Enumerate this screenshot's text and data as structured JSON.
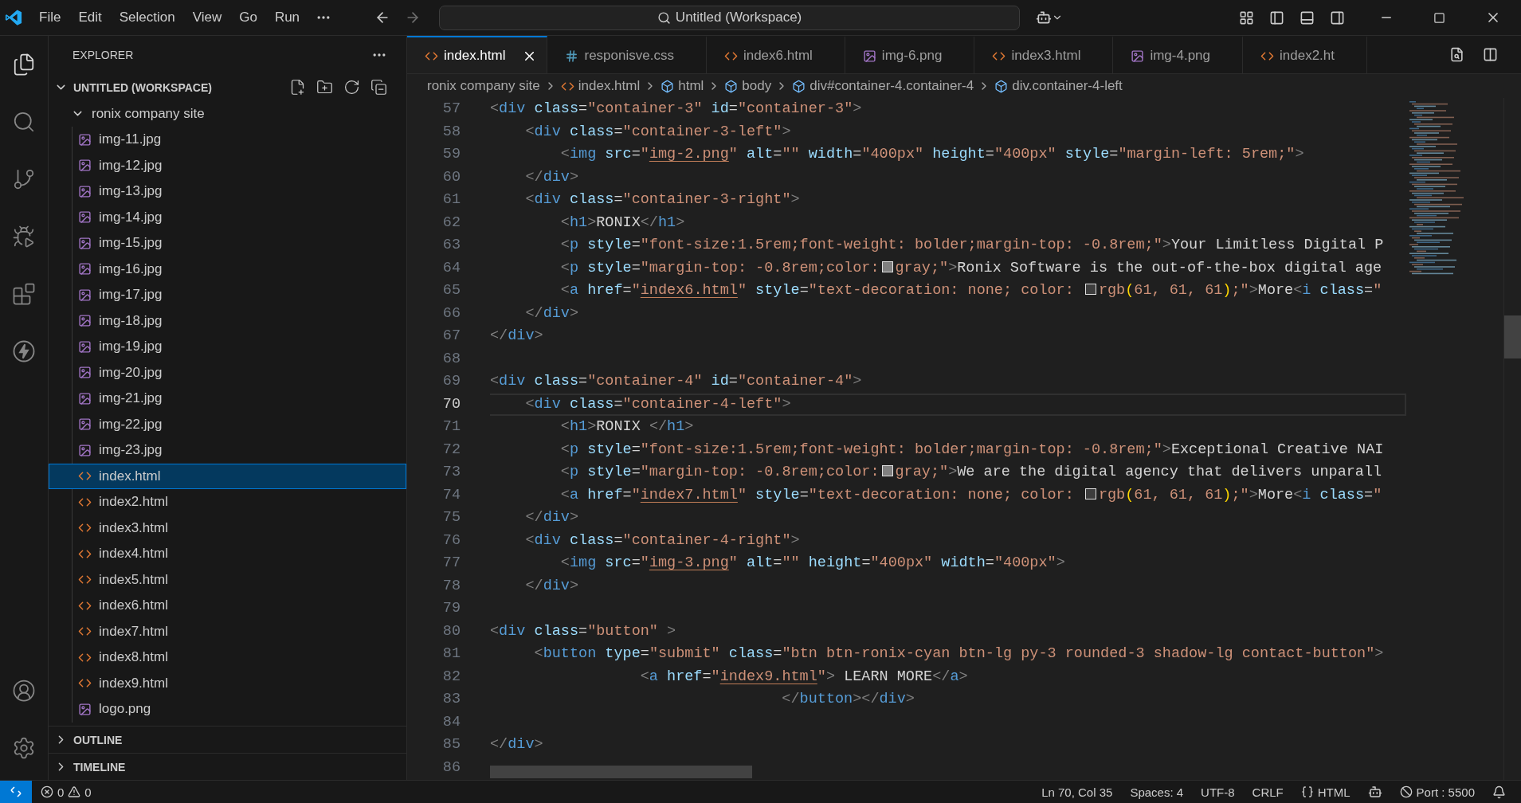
{
  "title_bar": {
    "menu": [
      "File",
      "Edit",
      "Selection",
      "View",
      "Go",
      "Run"
    ],
    "command_center": "Untitled (Workspace)"
  },
  "activity_bar": {
    "top": [
      {
        "kind": "explorer",
        "selected": true
      },
      {
        "kind": "search",
        "selected": false
      },
      {
        "kind": "source-control",
        "selected": false
      },
      {
        "kind": "run-debug",
        "selected": false
      },
      {
        "kind": "extensions",
        "selected": false
      },
      {
        "kind": "lightning",
        "selected": false
      }
    ],
    "bottom": [
      {
        "kind": "account"
      },
      {
        "kind": "settings"
      }
    ]
  },
  "sidebar": {
    "title": "EXPLORER",
    "workspace": {
      "name": "UNTITLED (WORKSPACE)",
      "expanded": true,
      "children": [
        {
          "name": "ronix company site",
          "expanded": true,
          "selected": false,
          "children": [
            {
              "name": "img-11.jpg",
              "kind": "image",
              "selected": false
            },
            {
              "name": "img-12.jpg",
              "kind": "image",
              "selected": false
            },
            {
              "name": "img-13.jpg",
              "kind": "image",
              "selected": false
            },
            {
              "name": "img-14.jpg",
              "kind": "image",
              "selected": false
            },
            {
              "name": "img-15.jpg",
              "kind": "image",
              "selected": false
            },
            {
              "name": "img-16.jpg",
              "kind": "image",
              "selected": false
            },
            {
              "name": "img-17.jpg",
              "kind": "image",
              "selected": false
            },
            {
              "name": "img-18.jpg",
              "kind": "image",
              "selected": false
            },
            {
              "name": "img-19.jpg",
              "kind": "image",
              "selected": false
            },
            {
              "name": "img-20.jpg",
              "kind": "image",
              "selected": false
            },
            {
              "name": "img-21.jpg",
              "kind": "image",
              "selected": false
            },
            {
              "name": "img-22.jpg",
              "kind": "image",
              "selected": false
            },
            {
              "name": "img-23.jpg",
              "kind": "image",
              "selected": false
            },
            {
              "name": "index.html",
              "kind": "html",
              "selected": true
            },
            {
              "name": "index2.html",
              "kind": "html",
              "selected": false
            },
            {
              "name": "index3.html",
              "kind": "html",
              "selected": false
            },
            {
              "name": "index4.html",
              "kind": "html",
              "selected": false
            },
            {
              "name": "index5.html",
              "kind": "html",
              "selected": false
            },
            {
              "name": "index6.html",
              "kind": "html",
              "selected": false
            },
            {
              "name": "index7.html",
              "kind": "html",
              "selected": false
            },
            {
              "name": "index8.html",
              "kind": "html",
              "selected": false
            },
            {
              "name": "index9.html",
              "kind": "html",
              "selected": false
            },
            {
              "name": "logo.png",
              "kind": "image",
              "selected": false
            }
          ]
        }
      ]
    },
    "sections": [
      {
        "name": "OUTLINE",
        "expanded": false
      },
      {
        "name": "TIMELINE",
        "expanded": false
      }
    ]
  },
  "tabs": [
    {
      "label": "index.html",
      "kind": "html",
      "selected": true
    },
    {
      "label": "responisve.css",
      "kind": "css",
      "selected": false
    },
    {
      "label": "index6.html",
      "kind": "html",
      "selected": false
    },
    {
      "label": "img-6.png",
      "kind": "image",
      "selected": false
    },
    {
      "label": "index3.html",
      "kind": "html",
      "selected": false
    },
    {
      "label": "img-4.png",
      "kind": "image",
      "selected": false
    },
    {
      "label": "index2.ht",
      "kind": "html",
      "selected": false
    }
  ],
  "breadcrumbs": [
    {
      "label": "ronix company site",
      "kind": "folder"
    },
    {
      "label": "index.html",
      "kind": "html"
    },
    {
      "label": "html",
      "kind": "element"
    },
    {
      "label": "body",
      "kind": "element"
    },
    {
      "label": "div#container-4.container-4",
      "kind": "element"
    },
    {
      "label": "div.container-4-left",
      "kind": "element"
    }
  ],
  "editor": {
    "lines": [
      {
        "number": "57",
        "current": false,
        "tokens": [
          {
            "kind": "p",
            "text": "<"
          },
          {
            "kind": "tag",
            "text": "div"
          },
          {
            "kind": "attr",
            "text": " class"
          },
          {
            "kind": "eq",
            "text": "="
          },
          {
            "kind": "str",
            "text": "\"container-3\""
          },
          {
            "kind": "attr",
            "text": " id"
          },
          {
            "kind": "eq",
            "text": "="
          },
          {
            "kind": "str",
            "text": "\"container-3\""
          },
          {
            "kind": "p",
            "text": ">"
          }
        ]
      },
      {
        "number": "58",
        "current": false,
        "tokens": [
          {
            "kind": "p",
            "text": "    <"
          },
          {
            "kind": "tag",
            "text": "div"
          },
          {
            "kind": "attr",
            "text": " class"
          },
          {
            "kind": "eq",
            "text": "="
          },
          {
            "kind": "str",
            "text": "\"container-3-left\""
          },
          {
            "kind": "p",
            "text": ">"
          }
        ]
      },
      {
        "number": "59",
        "current": false,
        "tokens": [
          {
            "kind": "p",
            "text": "        <"
          },
          {
            "kind": "tag",
            "text": "img"
          },
          {
            "kind": "attr",
            "text": " src"
          },
          {
            "kind": "eq",
            "text": "="
          },
          {
            "kind": "str",
            "text": "\""
          },
          {
            "kind": "link",
            "text": "img-2.png"
          },
          {
            "kind": "str",
            "text": "\""
          },
          {
            "kind": "attr",
            "text": " alt"
          },
          {
            "kind": "eq",
            "text": "="
          },
          {
            "kind": "str",
            "text": "\"\""
          },
          {
            "kind": "attr",
            "text": " width"
          },
          {
            "kind": "eq",
            "text": "="
          },
          {
            "kind": "str",
            "text": "\"400px\""
          },
          {
            "kind": "attr",
            "text": " height"
          },
          {
            "kind": "eq",
            "text": "="
          },
          {
            "kind": "str",
            "text": "\"400px\""
          },
          {
            "kind": "attr",
            "text": " style"
          },
          {
            "kind": "eq",
            "text": "="
          },
          {
            "kind": "str",
            "text": "\"margin-left: 5rem;\""
          },
          {
            "kind": "p",
            "text": ">"
          }
        ]
      },
      {
        "number": "60",
        "current": false,
        "tokens": [
          {
            "kind": "p",
            "text": "    </"
          },
          {
            "kind": "tag",
            "text": "div"
          },
          {
            "kind": "p",
            "text": ">"
          }
        ]
      },
      {
        "number": "61",
        "current": false,
        "tokens": [
          {
            "kind": "p",
            "text": "    <"
          },
          {
            "kind": "tag",
            "text": "div"
          },
          {
            "kind": "attr",
            "text": " class"
          },
          {
            "kind": "eq",
            "text": "="
          },
          {
            "kind": "str",
            "text": "\"container-3-right\""
          },
          {
            "kind": "p",
            "text": ">"
          }
        ]
      },
      {
        "number": "62",
        "current": false,
        "tokens": [
          {
            "kind": "p",
            "text": "        <"
          },
          {
            "kind": "tag",
            "text": "h1"
          },
          {
            "kind": "p",
            "text": ">"
          },
          {
            "kind": "txt",
            "text": "RONIX"
          },
          {
            "kind": "p",
            "text": "</"
          },
          {
            "kind": "tag",
            "text": "h1"
          },
          {
            "kind": "p",
            "text": ">"
          }
        ]
      },
      {
        "number": "63",
        "current": false,
        "tokens": [
          {
            "kind": "p",
            "text": "        <"
          },
          {
            "kind": "tag",
            "text": "p"
          },
          {
            "kind": "attr",
            "text": " style"
          },
          {
            "kind": "eq",
            "text": "="
          },
          {
            "kind": "str",
            "text": "\"font-size:1.5rem;font-weight: bolder;margin-top: -0.8rem;\""
          },
          {
            "kind": "p",
            "text": ">"
          },
          {
            "kind": "txt",
            "text": "Your Limitless Digital P"
          }
        ]
      },
      {
        "number": "64",
        "current": false,
        "tokens": [
          {
            "kind": "p",
            "text": "        <"
          },
          {
            "kind": "tag",
            "text": "p"
          },
          {
            "kind": "attr",
            "text": " style"
          },
          {
            "kind": "eq",
            "text": "="
          },
          {
            "kind": "str",
            "text": "\"margin-top: -0.8rem;color:"
          },
          {
            "kind": "swatch",
            "color": "#808080"
          },
          {
            "kind": "str",
            "text": "gray;\""
          },
          {
            "kind": "p",
            "text": ">"
          },
          {
            "kind": "txt",
            "text": "Ronix Software is the out-of-the-box digital age"
          }
        ]
      },
      {
        "number": "65",
        "current": false,
        "tokens": [
          {
            "kind": "p",
            "text": "        <"
          },
          {
            "kind": "tag",
            "text": "a"
          },
          {
            "kind": "attr",
            "text": " href"
          },
          {
            "kind": "eq",
            "text": "="
          },
          {
            "kind": "str",
            "text": "\""
          },
          {
            "kind": "link",
            "text": "index6.html"
          },
          {
            "kind": "str",
            "text": "\""
          },
          {
            "kind": "attr",
            "text": " style"
          },
          {
            "kind": "eq",
            "text": "="
          },
          {
            "kind": "str",
            "text": "\"text-decoration: none; color: "
          },
          {
            "kind": "swatch",
            "color": "#3d3d3d"
          },
          {
            "kind": "str",
            "text": "rgb"
          },
          {
            "kind": "br",
            "text": "("
          },
          {
            "kind": "str",
            "text": "61, 61, 61"
          },
          {
            "kind": "br",
            "text": ")"
          },
          {
            "kind": "str",
            "text": ";\""
          },
          {
            "kind": "p",
            "text": ">"
          },
          {
            "kind": "txt",
            "text": "More"
          },
          {
            "kind": "p",
            "text": "<"
          },
          {
            "kind": "tag",
            "text": "i"
          },
          {
            "kind": "attr",
            "text": " class"
          },
          {
            "kind": "eq",
            "text": "="
          },
          {
            "kind": "str",
            "text": "\""
          }
        ]
      },
      {
        "number": "66",
        "current": false,
        "tokens": [
          {
            "kind": "p",
            "text": "    </"
          },
          {
            "kind": "tag",
            "text": "div"
          },
          {
            "kind": "p",
            "text": ">"
          }
        ]
      },
      {
        "number": "67",
        "current": false,
        "tokens": [
          {
            "kind": "p",
            "text": "</"
          },
          {
            "kind": "tag",
            "text": "div"
          },
          {
            "kind": "p",
            "text": ">"
          }
        ]
      },
      {
        "number": "68",
        "current": false
      },
      {
        "number": "69",
        "current": false,
        "tokens": [
          {
            "kind": "p",
            "text": "<"
          },
          {
            "kind": "tag",
            "text": "div"
          },
          {
            "kind": "attr",
            "text": " class"
          },
          {
            "kind": "eq",
            "text": "="
          },
          {
            "kind": "str",
            "text": "\"container-4\""
          },
          {
            "kind": "attr",
            "text": " id"
          },
          {
            "kind": "eq",
            "text": "="
          },
          {
            "kind": "str",
            "text": "\"container-4\""
          },
          {
            "kind": "p",
            "text": ">"
          }
        ]
      },
      {
        "number": "70",
        "current": true,
        "tokens": [
          {
            "kind": "p",
            "text": "    <"
          },
          {
            "kind": "tag",
            "text": "div"
          },
          {
            "kind": "attr",
            "text": " class"
          },
          {
            "kind": "eq",
            "text": "="
          },
          {
            "kind": "str",
            "text": "\"container-4-left\""
          },
          {
            "kind": "p",
            "text": ">"
          }
        ]
      },
      {
        "number": "71",
        "current": false,
        "tokens": [
          {
            "kind": "p",
            "text": "        <"
          },
          {
            "kind": "tag",
            "text": "h1"
          },
          {
            "kind": "p",
            "text": ">"
          },
          {
            "kind": "txt",
            "text": "RONIX "
          },
          {
            "kind": "p",
            "text": "</"
          },
          {
            "kind": "tag",
            "text": "h1"
          },
          {
            "kind": "p",
            "text": ">"
          }
        ]
      },
      {
        "number": "72",
        "current": false,
        "tokens": [
          {
            "kind": "p",
            "text": "        <"
          },
          {
            "kind": "tag",
            "text": "p"
          },
          {
            "kind": "attr",
            "text": " style"
          },
          {
            "kind": "eq",
            "text": "="
          },
          {
            "kind": "str",
            "text": "\"font-size:1.5rem;font-weight: bolder;margin-top: -0.8rem;\""
          },
          {
            "kind": "p",
            "text": ">"
          },
          {
            "kind": "txt",
            "text": "Exceptional Creative NAI"
          }
        ]
      },
      {
        "number": "73",
        "current": false,
        "tokens": [
          {
            "kind": "p",
            "text": "        <"
          },
          {
            "kind": "tag",
            "text": "p"
          },
          {
            "kind": "attr",
            "text": " style"
          },
          {
            "kind": "eq",
            "text": "="
          },
          {
            "kind": "str",
            "text": "\"margin-top: -0.8rem;color:"
          },
          {
            "kind": "swatch",
            "color": "#808080"
          },
          {
            "kind": "str",
            "text": "gray;\""
          },
          {
            "kind": "p",
            "text": ">"
          },
          {
            "kind": "txt",
            "text": "We are the digital agency that delivers unparall"
          }
        ]
      },
      {
        "number": "74",
        "current": false,
        "tokens": [
          {
            "kind": "p",
            "text": "        <"
          },
          {
            "kind": "tag",
            "text": "a"
          },
          {
            "kind": "attr",
            "text": " href"
          },
          {
            "kind": "eq",
            "text": "="
          },
          {
            "kind": "str",
            "text": "\""
          },
          {
            "kind": "link",
            "text": "index7.html"
          },
          {
            "kind": "str",
            "text": "\""
          },
          {
            "kind": "attr",
            "text": " style"
          },
          {
            "kind": "eq",
            "text": "="
          },
          {
            "kind": "str",
            "text": "\"text-decoration: none; color: "
          },
          {
            "kind": "swatch",
            "color": "#3d3d3d"
          },
          {
            "kind": "str",
            "text": "rgb"
          },
          {
            "kind": "br",
            "text": "("
          },
          {
            "kind": "str",
            "text": "61, 61, 61"
          },
          {
            "kind": "br",
            "text": ")"
          },
          {
            "kind": "str",
            "text": ";\""
          },
          {
            "kind": "p",
            "text": ">"
          },
          {
            "kind": "txt",
            "text": "More"
          },
          {
            "kind": "p",
            "text": "<"
          },
          {
            "kind": "tag",
            "text": "i"
          },
          {
            "kind": "attr",
            "text": " class"
          },
          {
            "kind": "eq",
            "text": "="
          },
          {
            "kind": "str",
            "text": "\""
          }
        ]
      },
      {
        "number": "75",
        "current": false,
        "tokens": [
          {
            "kind": "p",
            "text": "    </"
          },
          {
            "kind": "tag",
            "text": "div"
          },
          {
            "kind": "p",
            "text": ">"
          }
        ]
      },
      {
        "number": "76",
        "current": false,
        "tokens": [
          {
            "kind": "p",
            "text": "    <"
          },
          {
            "kind": "tag",
            "text": "div"
          },
          {
            "kind": "attr",
            "text": " class"
          },
          {
            "kind": "eq",
            "text": "="
          },
          {
            "kind": "str",
            "text": "\"container-4-right\""
          },
          {
            "kind": "p",
            "text": ">"
          }
        ]
      },
      {
        "number": "77",
        "current": false,
        "tokens": [
          {
            "kind": "p",
            "text": "        <"
          },
          {
            "kind": "tag",
            "text": "img"
          },
          {
            "kind": "attr",
            "text": " src"
          },
          {
            "kind": "eq",
            "text": "="
          },
          {
            "kind": "str",
            "text": "\""
          },
          {
            "kind": "link",
            "text": "img-3.png"
          },
          {
            "kind": "str",
            "text": "\""
          },
          {
            "kind": "attr",
            "text": " alt"
          },
          {
            "kind": "eq",
            "text": "="
          },
          {
            "kind": "str",
            "text": "\"\""
          },
          {
            "kind": "attr",
            "text": " height"
          },
          {
            "kind": "eq",
            "text": "="
          },
          {
            "kind": "str",
            "text": "\"400px\""
          },
          {
            "kind": "attr",
            "text": " width"
          },
          {
            "kind": "eq",
            "text": "="
          },
          {
            "kind": "str",
            "text": "\"400px\""
          },
          {
            "kind": "p",
            "text": ">"
          }
        ]
      },
      {
        "number": "78",
        "current": false,
        "tokens": [
          {
            "kind": "p",
            "text": "    </"
          },
          {
            "kind": "tag",
            "text": "div"
          },
          {
            "kind": "p",
            "text": ">"
          }
        ]
      },
      {
        "number": "79",
        "current": false
      },
      {
        "number": "80",
        "current": false,
        "tokens": [
          {
            "kind": "p",
            "text": "<"
          },
          {
            "kind": "tag",
            "text": "div"
          },
          {
            "kind": "attr",
            "text": " class"
          },
          {
            "kind": "eq",
            "text": "="
          },
          {
            "kind": "str",
            "text": "\"button\""
          },
          {
            "kind": "p",
            "text": " >"
          }
        ]
      },
      {
        "number": "81",
        "current": false,
        "tokens": [
          {
            "kind": "p",
            "text": "     <"
          },
          {
            "kind": "tag",
            "text": "button"
          },
          {
            "kind": "attr",
            "text": " type"
          },
          {
            "kind": "eq",
            "text": "="
          },
          {
            "kind": "str",
            "text": "\"submit\""
          },
          {
            "kind": "attr",
            "text": " class"
          },
          {
            "kind": "eq",
            "text": "="
          },
          {
            "kind": "str",
            "text": "\"btn btn-ronix-cyan btn-lg py-3 rounded-3 shadow-lg contact-button\""
          },
          {
            "kind": "p",
            "text": ">"
          }
        ]
      },
      {
        "number": "82",
        "current": false,
        "tokens": [
          {
            "kind": "p",
            "text": "                 <"
          },
          {
            "kind": "tag",
            "text": "a"
          },
          {
            "kind": "attr",
            "text": " href"
          },
          {
            "kind": "eq",
            "text": "="
          },
          {
            "kind": "str",
            "text": "\""
          },
          {
            "kind": "link",
            "text": "index9.html"
          },
          {
            "kind": "str",
            "text": "\""
          },
          {
            "kind": "p",
            "text": ">"
          },
          {
            "kind": "txt",
            "text": " LEARN MORE"
          },
          {
            "kind": "p",
            "text": "</"
          },
          {
            "kind": "tag",
            "text": "a"
          },
          {
            "kind": "p",
            "text": ">"
          }
        ]
      },
      {
        "number": "83",
        "current": false,
        "tokens": [
          {
            "kind": "p",
            "text": "                                 </"
          },
          {
            "kind": "tag",
            "text": "button"
          },
          {
            "kind": "p",
            "text": "></"
          },
          {
            "kind": "tag",
            "text": "div"
          },
          {
            "kind": "p",
            "text": ">"
          }
        ]
      },
      {
        "number": "84",
        "current": false
      },
      {
        "number": "85",
        "current": false,
        "tokens": [
          {
            "kind": "p",
            "text": "</"
          },
          {
            "kind": "tag",
            "text": "div"
          },
          {
            "kind": "p",
            "text": ">"
          }
        ]
      },
      {
        "number": "86",
        "current": false
      }
    ]
  },
  "status_bar": {
    "errors": "0",
    "warnings": "0",
    "items": [
      {
        "kind": "text",
        "text": "Ln 70, Col 35"
      },
      {
        "kind": "text",
        "text": "Spaces: 4"
      },
      {
        "kind": "text",
        "text": "UTF-8"
      },
      {
        "kind": "text",
        "text": "CRLF"
      },
      {
        "kind": "language",
        "text": "HTML"
      },
      {
        "kind": "copilot"
      },
      {
        "kind": "port",
        "text": "Port : 5500"
      },
      {
        "kind": "bell"
      }
    ]
  }
}
